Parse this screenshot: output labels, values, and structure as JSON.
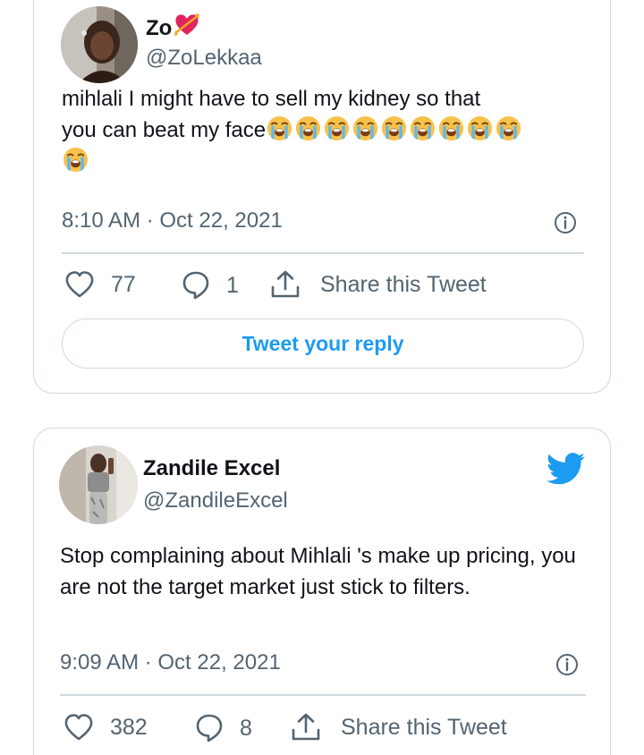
{
  "tweets": [
    {
      "name": "Zo",
      "name_emoji": "heart-with-arrow",
      "handle": "@ZoLekkaa",
      "text_line1": "mihlali I might have to sell my kidney so that",
      "text_line2": "you can beat my face",
      "emoji": "loudly-crying-face",
      "emoji_count": 10,
      "timestamp": "8:10 AM · Oct 22, 2021",
      "likes": "77",
      "replies": "1",
      "share_label": "Share this Tweet",
      "reply_button_label": "Tweet your reply"
    },
    {
      "name": "Zandile Excel",
      "handle": "@ZandileExcel",
      "text": "Stop complaining about Mihlali 's make up pricing, you are not the target market just stick to filters.",
      "timestamp": "9:09 AM · Oct 22, 2021",
      "likes": "382",
      "replies": "8",
      "share_label": "Share this Tweet"
    }
  ],
  "icons": {
    "like": "heart-outline-icon",
    "reply": "speech-bubble-icon",
    "share": "upload-share-icon",
    "info": "info-circle-icon",
    "brand": "twitter-bird-icon"
  },
  "colors": {
    "brand_blue": "#1d9bf0",
    "text_primary": "#0f1419",
    "text_secondary": "#536471",
    "border": "#cfd9de",
    "emoji_heart": "#e0245e"
  }
}
